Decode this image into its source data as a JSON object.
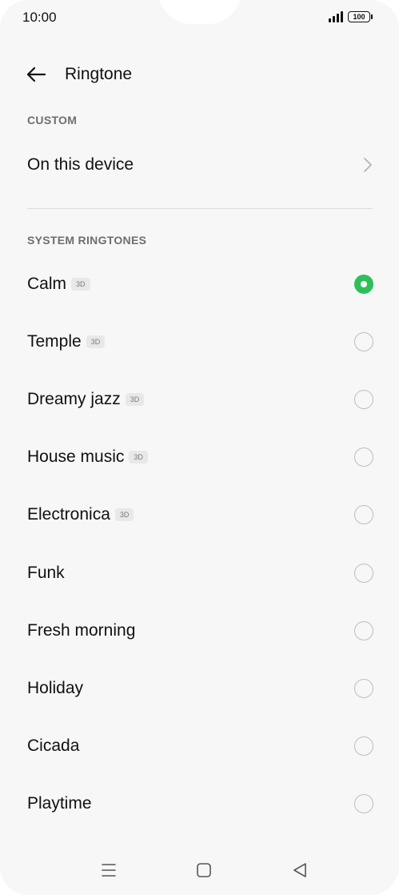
{
  "status_bar": {
    "time": "10:00",
    "battery": "100"
  },
  "header": {
    "title": "Ringtone"
  },
  "custom_section": {
    "label": "CUSTOM",
    "items": [
      {
        "label": "On this device"
      }
    ]
  },
  "system_section": {
    "label": "SYSTEM RINGTONES",
    "badge_text": "3D",
    "items": [
      {
        "label": "Calm",
        "badge": "3D",
        "selected": true
      },
      {
        "label": "Temple",
        "badge": "3D",
        "selected": false
      },
      {
        "label": "Dreamy jazz",
        "badge": "3D",
        "selected": false
      },
      {
        "label": "House music",
        "badge": "3D",
        "selected": false
      },
      {
        "label": "Electronica",
        "badge": "3D",
        "selected": false
      },
      {
        "label": "Funk",
        "selected": false
      },
      {
        "label": "Fresh morning",
        "selected": false
      },
      {
        "label": "Holiday",
        "selected": false
      },
      {
        "label": "Cicada",
        "selected": false
      },
      {
        "label": "Playtime",
        "selected": false
      }
    ]
  },
  "colors": {
    "accent": "#2fbf5a",
    "text": "#111111",
    "section_label": "#6e6e6e"
  },
  "nav_bar": {
    "icons": [
      "menu-icon",
      "home-square-icon",
      "back-triangle-icon"
    ]
  }
}
